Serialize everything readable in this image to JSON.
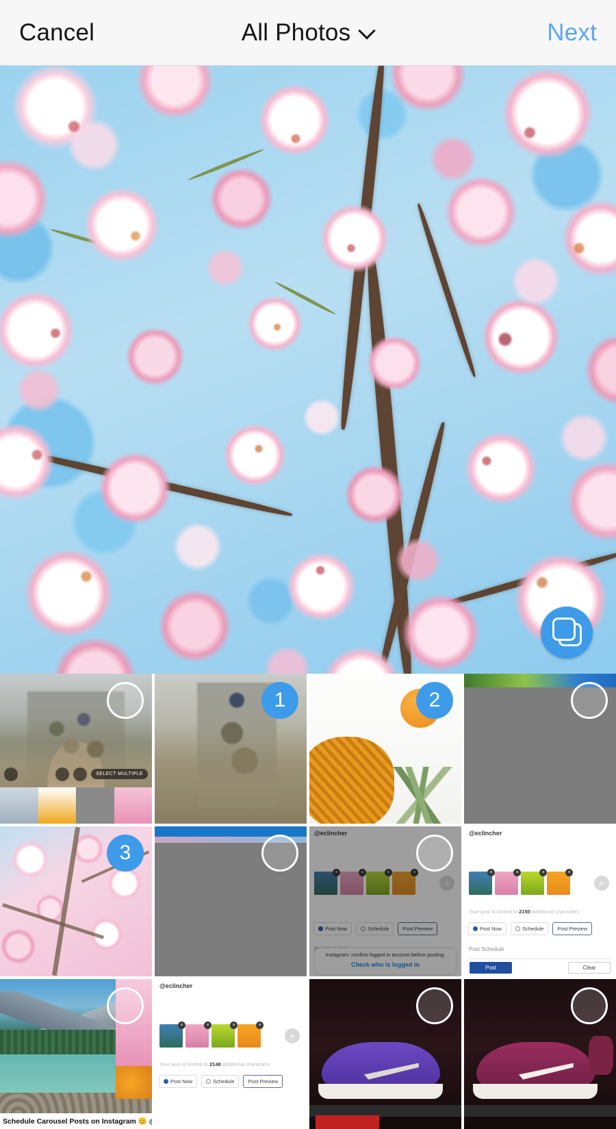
{
  "header": {
    "cancel_label": "Cancel",
    "album_title": "All Photos",
    "next_label": "Next",
    "chevron_icon": "chevron-down-icon",
    "accent_color": "#5ba7ef",
    "background_color": "#f7f7f7"
  },
  "preview": {
    "image_description": "Cherry blossom tree in bloom with blue sky",
    "carousel_button": {
      "icon": "multi-select-stacked-squares-icon",
      "color": "#3e9bea"
    }
  },
  "grid": {
    "selected_color": "#3e9bea",
    "items": [
      {
        "id": 1,
        "art": "t-mont",
        "selected": false,
        "badge": "",
        "overlay_text": "SELECT MULTIPLE"
      },
      {
        "id": 2,
        "art": "t-mont2",
        "selected": true,
        "badge": "1"
      },
      {
        "id": 3,
        "art": "t-fruit",
        "selected": true,
        "badge": "2"
      },
      {
        "id": 4,
        "art": "t-gray",
        "selected": false,
        "badge": ""
      },
      {
        "id": 5,
        "art": "t-blossom",
        "selected": true,
        "badge": "3"
      },
      {
        "id": 6,
        "art": "t-gray-blue",
        "selected": false,
        "badge": ""
      },
      {
        "id": 7,
        "art": "t-app-dim",
        "selected": false,
        "badge": ""
      },
      {
        "id": 8,
        "art": "t-app",
        "selected": false,
        "badge": ""
      },
      {
        "id": 9,
        "art": "t-lake",
        "selected": false,
        "badge": ""
      },
      {
        "id": 10,
        "art": "t-app2",
        "selected": false,
        "badge": ""
      },
      {
        "id": 11,
        "art": "t-shoe-purple",
        "selected": false,
        "badge": ""
      },
      {
        "id": 12,
        "art": "t-shoe-maroon",
        "selected": false,
        "badge": ""
      }
    ]
  },
  "app_screenshot": {
    "handle": "@eclincher",
    "caption": "Schedule Carousel Posts on Instagram 😊 @eclincher",
    "limit_prefix": "Your post is limited to",
    "limit_suffix": "additional characters",
    "limit_count_a": "2150",
    "limit_count_b": "2148",
    "post_now_label": "Post Now",
    "schedule_label": "Schedule",
    "post_preview_label": "Post Preview",
    "post_schedule_label": "Post Schedule",
    "alert_text": "Instagram: confirm logged in account before posting.",
    "alert_link": "Check who is logged in",
    "post_button_label": "Post",
    "clear_button_label": "Clear",
    "remove_icon": "x-remove-icon",
    "add_icon": "plus-add-icon",
    "clock_icon": "clock-icon"
  }
}
